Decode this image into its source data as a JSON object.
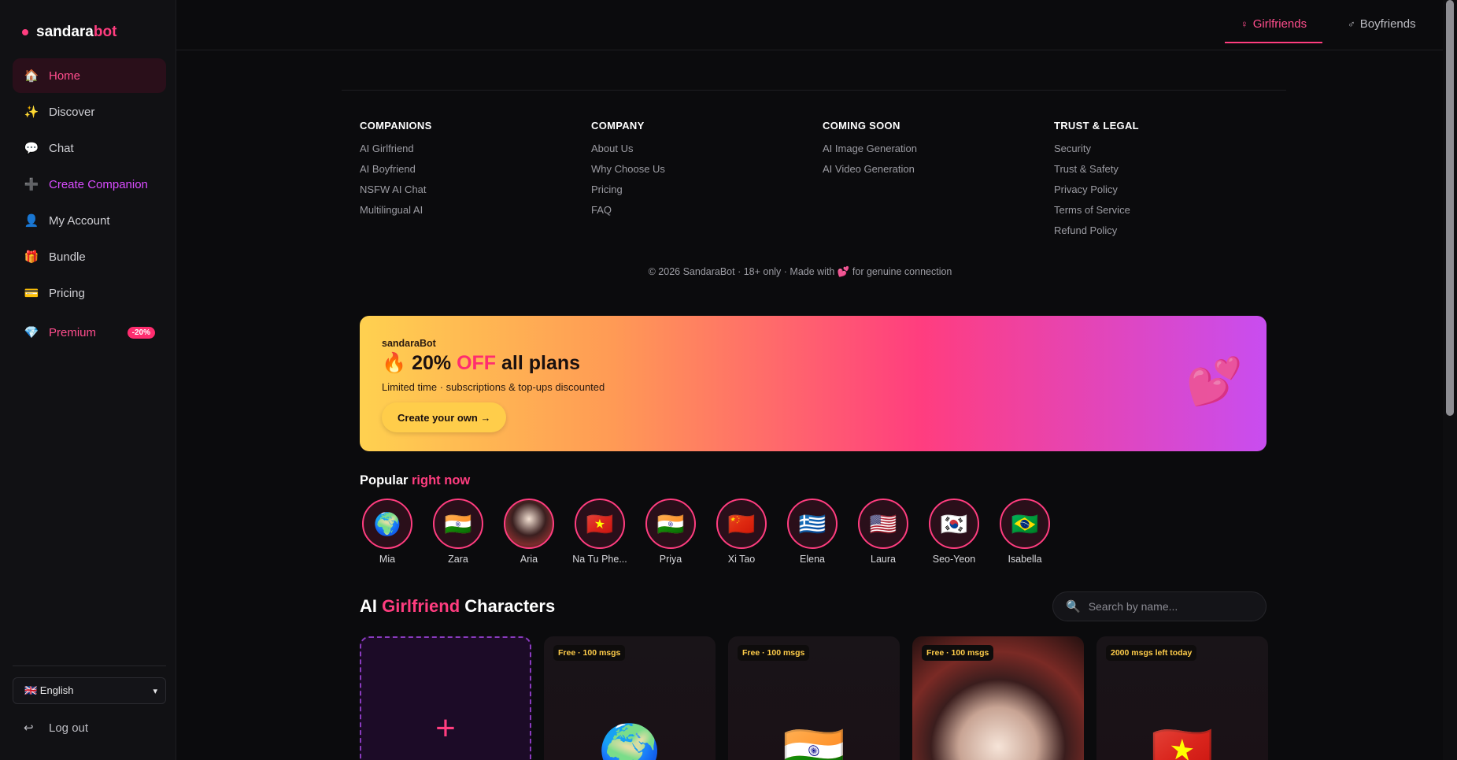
{
  "logo": {
    "prefix": "sandara",
    "suffix": "bot"
  },
  "sidebar": {
    "items": [
      {
        "icon": "home-icon",
        "glyph": "🏠",
        "label": "Home"
      },
      {
        "icon": "sparkles-icon",
        "glyph": "✨",
        "label": "Discover"
      },
      {
        "icon": "chat-icon",
        "glyph": "💬",
        "label": "Chat"
      },
      {
        "icon": "plus-icon",
        "glyph": "➕",
        "label": "Create Companion"
      },
      {
        "icon": "user-icon",
        "glyph": "👤",
        "label": "My Account"
      },
      {
        "icon": "gift-icon",
        "glyph": "🎁",
        "label": "Bundle"
      },
      {
        "icon": "card-icon",
        "glyph": "💳",
        "label": "Pricing"
      }
    ],
    "premium": {
      "glyph": "💎",
      "label": "Premium",
      "badge": "-20%"
    },
    "language": "🇬🇧 English",
    "logout": {
      "glyph": "↩",
      "label": "Log out"
    }
  },
  "header": {
    "tabs": [
      {
        "symbol": "♀",
        "label": "Girlfriends"
      },
      {
        "symbol": "♂",
        "label": "Boyfriends"
      }
    ]
  },
  "footer": {
    "columns": [
      {
        "title": "COMPANIONS",
        "links": [
          "AI Girlfriend",
          "AI Boyfriend",
          "NSFW AI Chat",
          "Multilingual AI"
        ]
      },
      {
        "title": "COMPANY",
        "links": [
          "About Us",
          "Why Choose Us",
          "Pricing",
          "FAQ"
        ]
      },
      {
        "title": "COMING SOON",
        "links": [
          "AI Image Generation",
          "AI Video Generation"
        ]
      },
      {
        "title": "TRUST & LEGAL",
        "links": [
          "Security",
          "Trust & Safety",
          "Privacy Policy",
          "Terms of Service",
          "Refund Policy"
        ]
      }
    ],
    "copyright": "© 2026 SandaraBot · 18+ only · Made with 💕 for genuine connection"
  },
  "promo": {
    "brand": "sandaraBot",
    "headline_pre": "🔥 20% ",
    "headline_off": "OFF",
    "headline_post": " all plans",
    "subtitle": "Limited time · subscriptions & top-ups discounted",
    "cta": "Create your own →",
    "hearts": "💕"
  },
  "popular": {
    "title_pre": "Popular ",
    "title_accent": "right now",
    "avatars": [
      {
        "name": "Mia",
        "flag": "🌍"
      },
      {
        "name": "Zara",
        "flag": "🇮🇳"
      },
      {
        "name": "Aria",
        "flag": ""
      },
      {
        "name": "Na Tu Phe...",
        "flag": "🇻🇳"
      },
      {
        "name": "Priya",
        "flag": "🇮🇳"
      },
      {
        "name": "Xi Tao",
        "flag": "🇨🇳"
      },
      {
        "name": "Elena",
        "flag": "🇬🇷"
      },
      {
        "name": "Laura",
        "flag": "🇺🇸"
      },
      {
        "name": "Seo-Yeon",
        "flag": "🇰🇷"
      },
      {
        "name": "Isabella",
        "flag": "🇧🇷"
      }
    ]
  },
  "characters": {
    "title_pre": "AI ",
    "title_accent": "Girlfriend",
    "title_post": " Characters",
    "search_placeholder": "Search by name...",
    "cards": [
      {
        "tag": "",
        "art": "+"
      },
      {
        "tag": "Free · 100 msgs",
        "art": "🌍"
      },
      {
        "tag": "Free · 100 msgs",
        "art": "🇮🇳"
      },
      {
        "tag": "Free · 100 msgs",
        "art": ""
      },
      {
        "tag": "2000 msgs left today",
        "art": "🇻🇳"
      }
    ]
  },
  "colors": {
    "accent": "#ff3d7f",
    "create": "#d94cff",
    "bg": "#0b0b0d",
    "sidebar": "#111114"
  }
}
